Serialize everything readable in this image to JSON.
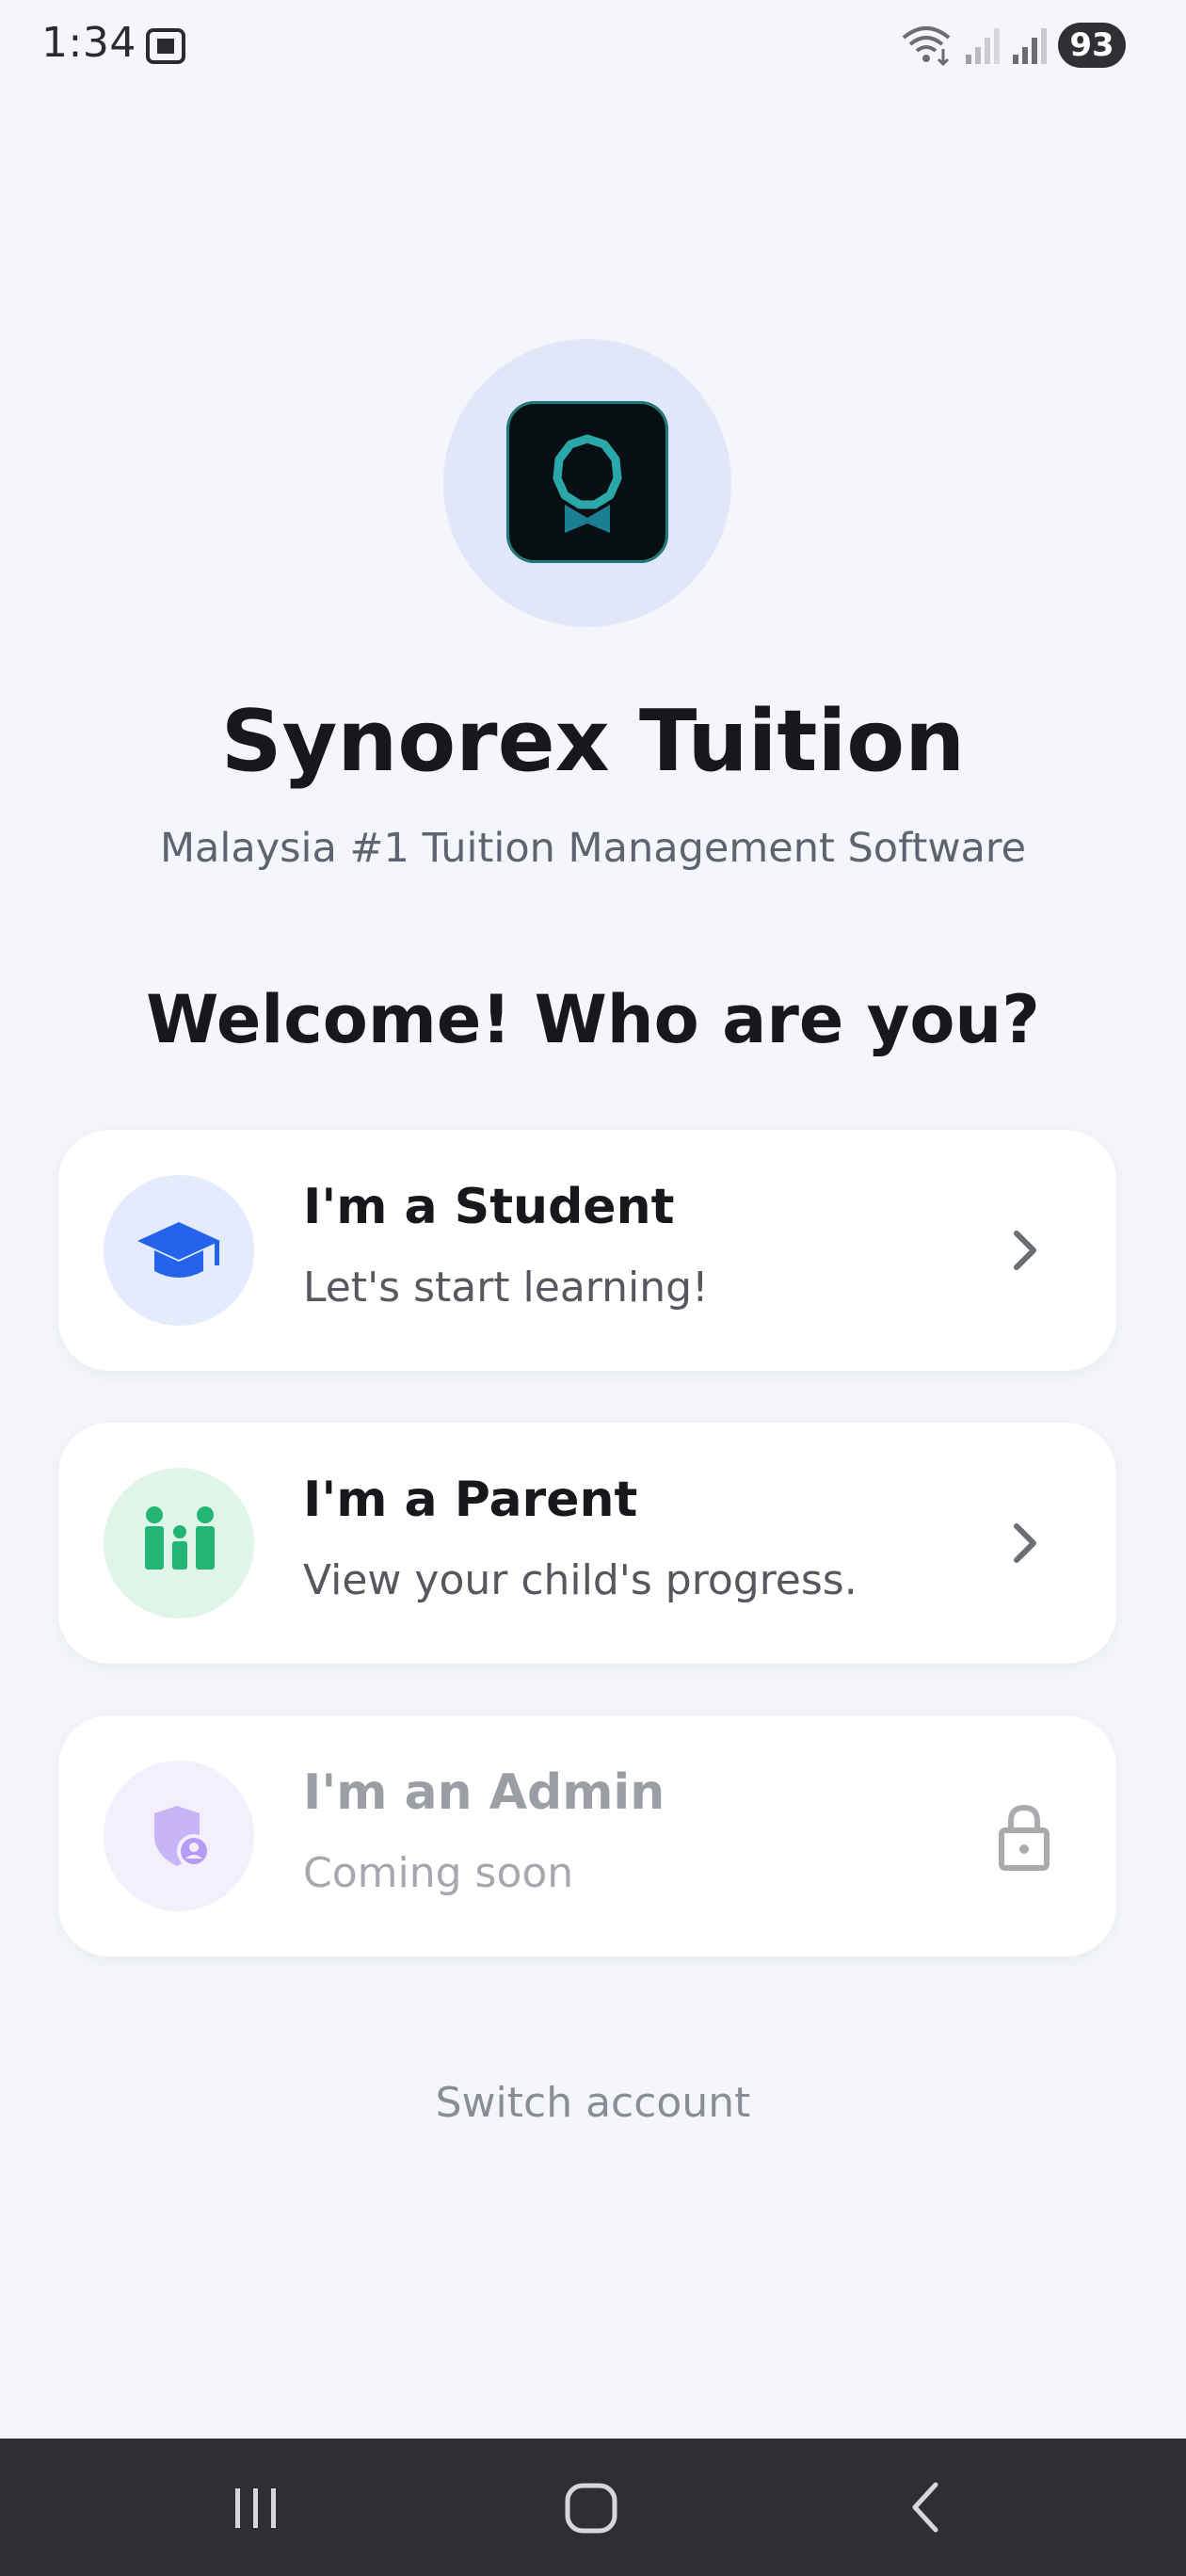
{
  "status_bar": {
    "time": "1:34",
    "battery": "93"
  },
  "app": {
    "name": "Synorex Tuition",
    "tagline": "Malaysia #1 Tuition Management Software"
  },
  "welcome": {
    "heading": "Welcome! Who are you?"
  },
  "roles": [
    {
      "title": "I'm a Student",
      "description": "Let's start learning!",
      "icon": "graduation-cap-icon",
      "trailing": "chevron-right-icon"
    },
    {
      "title": "I'm a Parent",
      "description": "View your child's progress.",
      "icon": "family-icon",
      "trailing": "chevron-right-icon"
    },
    {
      "title": "I'm an Admin",
      "description": "Coming soon",
      "icon": "admin-shield-icon",
      "trailing": "lock-icon"
    }
  ],
  "footer": {
    "switch_account": "Switch account"
  },
  "colors": {
    "background": "#f4f6fb",
    "student_accent": "#2563eb",
    "parent_accent": "#22b573",
    "admin_accent": "#b79cf5"
  }
}
